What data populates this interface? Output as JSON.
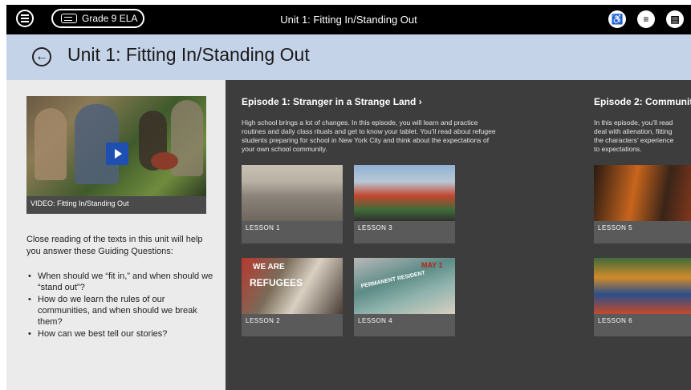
{
  "topbar": {
    "grade_label": "Grade 9 ELA",
    "title": "Unit 1: Fitting In/Standing Out"
  },
  "header": {
    "title": "Unit 1: Fitting In/Standing Out"
  },
  "video": {
    "caption": "VIDEO: Fitting In/Standing Out"
  },
  "intro": "Close reading of the texts in this unit will help you answer these Guiding Questions:",
  "questions": [
    "When should we “fit in,” and when should we “stand out”?",
    "How do we learn the rules of our communities, and when should we break them?",
    "How can we best tell our stories?"
  ],
  "episodes": [
    {
      "title": "Episode 1: Stranger in a Strange Land ›",
      "desc_lines": [
        "High school brings a lot of changes. In this episode, you will learn and practice",
        "routines and daily class rituals and get to know your tablet. You’ll read about refugee",
        "students preparing for school in New York City and think about the expectations of",
        "your own school community."
      ],
      "lessons": [
        "LESSON 1",
        "LESSON 2",
        "LESSON 3",
        "LESSON 4"
      ]
    },
    {
      "title": "Episode 2: Communit",
      "desc_lines": [
        "In this episode, you’ll read",
        "deal with alienation, fitting",
        "the characters’ experience",
        "to expectations."
      ],
      "lessons": [
        "LESSON 5",
        "LESSON 6"
      ]
    }
  ],
  "thumb_text": {
    "we_are": "WE ARE",
    "refugees": "REFUGEES",
    "may": "MAY 1",
    "permanent_resident": "PERMANENT RESIDENT"
  },
  "colors": {
    "topbar": "#000000",
    "header": "#c5d3e8",
    "left_panel": "#ebebeb",
    "content": "#3d3d3d",
    "play": "#1f4fb0"
  },
  "icons": {
    "menu": "hamburger-icon",
    "grade": "tablet-icon",
    "icon1": "accessibility-icon",
    "icon2": "notes-icon",
    "icon3": "clipboard-icon",
    "back": "back-arrow-icon"
  }
}
